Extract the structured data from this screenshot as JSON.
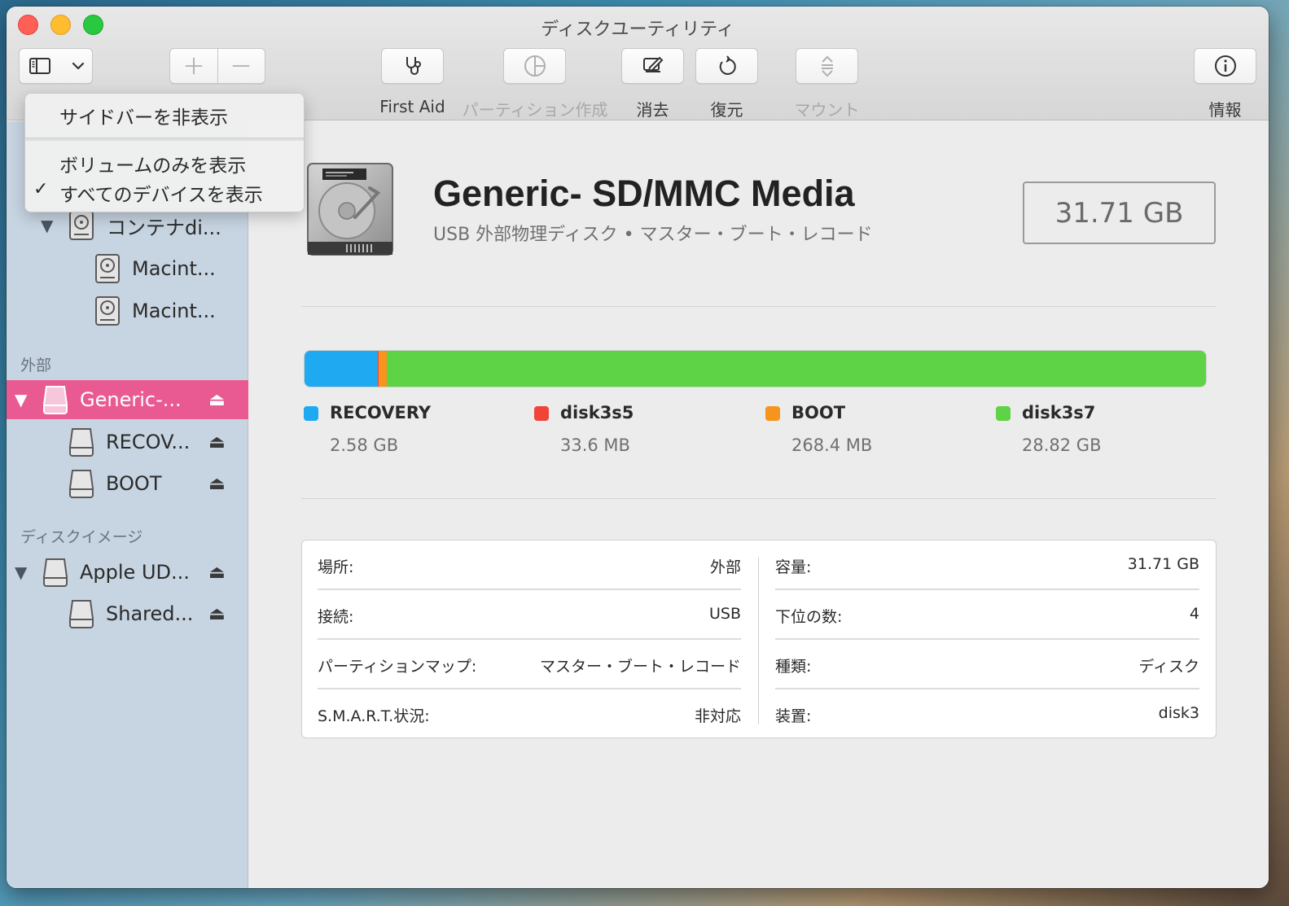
{
  "window": {
    "title": "ディスクユーティリティ"
  },
  "toolbar": {
    "buttons": [
      {
        "label": "First Aid",
        "icon": "stethoscope-icon",
        "enabled": true
      },
      {
        "label": "パーティション作成",
        "icon": "partition-pie-icon",
        "enabled": false
      },
      {
        "label": "消去",
        "icon": "erase-pencil-icon",
        "enabled": true
      },
      {
        "label": "復元",
        "icon": "restore-arrow-icon",
        "enabled": true
      },
      {
        "label": "マウント",
        "icon": "mount-icon",
        "enabled": false
      },
      {
        "label": "情報",
        "icon": "info-icon",
        "enabled": true
      }
    ]
  },
  "view_menu": {
    "items": [
      "サイドバーを非表示",
      "ボリュームのみを表示",
      "すべてのデバイスを表示"
    ],
    "checked_index": 2
  },
  "sidebar": {
    "internal_rows": [
      "コンテナdi...",
      "Macint...",
      "Macint..."
    ],
    "external_section": "外部",
    "external_rows": [
      "Generic-...",
      "RECOV...",
      "BOOT"
    ],
    "images_section": "ディスクイメージ",
    "image_rows": [
      "Apple UD...",
      "Shared..."
    ]
  },
  "device": {
    "name": "Generic- SD/MMC Media",
    "subtitle": "USB 外部物理ディスク • マスター・ブート・レコード",
    "capacity": "31.71 GB"
  },
  "partitions": [
    {
      "name": "RECOVERY",
      "size": "2.58 GB",
      "size_gb": 2.58,
      "color": "#1fa9f0"
    },
    {
      "name": "disk3s5",
      "size": "33.6 MB",
      "size_gb": 0.0336,
      "color": "#f0433a"
    },
    {
      "name": "BOOT",
      "size": "268.4 MB",
      "size_gb": 0.2684,
      "color": "#f7941d"
    },
    {
      "name": "disk3s7",
      "size": "28.82 GB",
      "size_gb": 28.82,
      "color": "#5ed346"
    }
  ],
  "info": {
    "left": [
      {
        "key": "場所:",
        "value": "外部"
      },
      {
        "key": "接続:",
        "value": "USB"
      },
      {
        "key": "パーティションマップ:",
        "value": "マスター・ブート・レコード"
      },
      {
        "key": "S.M.A.R.T.状況:",
        "value": "非対応"
      }
    ],
    "right": [
      {
        "key": "容量:",
        "value": "31.71 GB"
      },
      {
        "key": "下位の数:",
        "value": "4"
      },
      {
        "key": "種類:",
        "value": "ディスク"
      },
      {
        "key": "装置:",
        "value": "disk3"
      }
    ]
  },
  "colors": {
    "selection": "#ea5a92",
    "sidebar": "#c7d4e1"
  }
}
